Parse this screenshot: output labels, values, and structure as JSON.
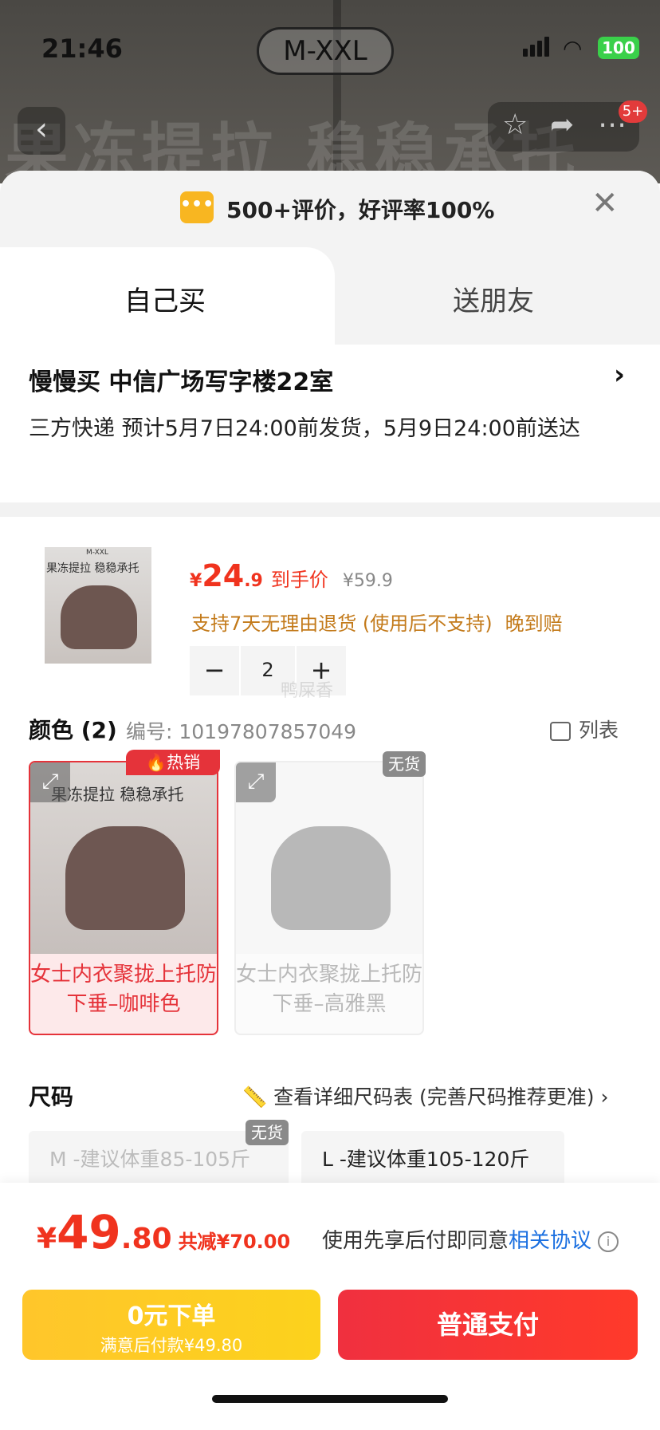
{
  "status_bar": {
    "time": "21:46",
    "battery": "100"
  },
  "header": {
    "size_pill": "M-XXL",
    "banner_text": "果冻提拉 稳稳承托",
    "notification_badge": "5+"
  },
  "review_bar": {
    "text": "500+评价，好评率100%"
  },
  "tabs": {
    "buy_self": "自己买",
    "gift": "送朋友"
  },
  "address": {
    "line": "慢慢买  中信广场写字楼22室",
    "shipping": "三方快递 预计5月7日24:00前发货，5月9日24:00前送达"
  },
  "product": {
    "thumb_text": "果冻提拉 稳稳承托",
    "thumb_mark": "M-XXL",
    "price_symbol": "¥",
    "price_int": "24",
    "price_dec": ".9",
    "price_label": "到手价",
    "original_price": "¥59.9",
    "policy": "支持7天无理由退货 (使用后不支持)",
    "late_comp": "晚到赔",
    "quantity": "2",
    "watermark": "鸭屎香"
  },
  "color_section": {
    "title": "颜色 (2)",
    "code": "编号: 10197807857049",
    "list_view": "列表",
    "hot_badge": "热销",
    "nostock_badge": "无货",
    "options": [
      {
        "name": "女士内衣聚拢上托防下垂–咖啡色",
        "img_text": "果冻提拉 稳稳承托"
      },
      {
        "name": "女士内衣聚拢上托防下垂–高雅黑",
        "img_text": ""
      }
    ]
  },
  "size_section": {
    "title": "尺码",
    "chart_link": "查看详细尺码表 (完善尺码推荐更准)",
    "nostock_badge": "无货",
    "options": [
      "M -建议体重85-105斤",
      "L -建议体重105-120斤"
    ]
  },
  "footer": {
    "total_symbol": "¥",
    "total_int": "49",
    "total_dec": ".80",
    "reduction": "共减¥70.00",
    "agree_prefix": "使用先享后付即同意",
    "agree_link": "相关协议",
    "zero_btn_title": "0元下单",
    "zero_btn_sub": "满意后付款¥49.80",
    "pay_btn": "普通支付"
  },
  "colors": {
    "accent_red": "#f0331e",
    "policy_orange": "#c37a1a",
    "link_blue": "#1a6fe0",
    "zero_btn_yellow": "#ffc62b"
  }
}
